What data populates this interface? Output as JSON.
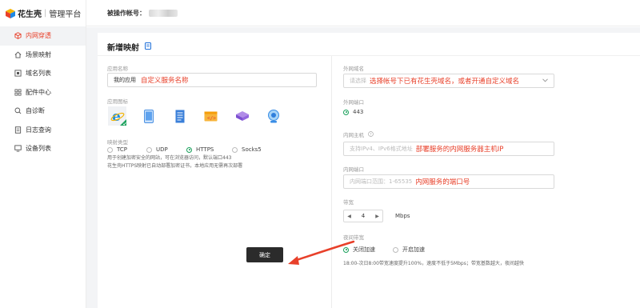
{
  "brand": {
    "name": "花生壳",
    "subtitle": "管理平台"
  },
  "header": {
    "account_label": "被操作帐号："
  },
  "sidebar": {
    "items": [
      {
        "label": "内网穿透",
        "icon": "cube-icon",
        "active": true
      },
      {
        "label": "场景映射",
        "icon": "home-icon",
        "active": false
      },
      {
        "label": "域名列表",
        "icon": "domain-icon",
        "active": false
      },
      {
        "label": "配件中心",
        "icon": "grid-icon",
        "active": false
      },
      {
        "label": "自诊断",
        "icon": "diagnose-icon",
        "active": false
      },
      {
        "label": "日志查询",
        "icon": "log-icon",
        "active": false
      },
      {
        "label": "设备列表",
        "icon": "monitor-icon",
        "active": false
      }
    ]
  },
  "form": {
    "title": "新增映射",
    "app_name": {
      "label": "应用名称",
      "value": "我的应用",
      "annotation": "自定义服务名称"
    },
    "app_icon": {
      "label": "应用图标",
      "icons": [
        "ie-browser-icon",
        "phone-icon",
        "document-icon",
        "code-icon",
        "database-icon",
        "webcam-icon"
      ]
    },
    "mapping_type": {
      "label": "映射类型",
      "options": [
        "TCP",
        "UDP",
        "HTTPS",
        "Socks5"
      ],
      "selected": "HTTPS"
    },
    "hint_lines": [
      "用于创建加密安全的网站，可在浏览器访问，默认端口443",
      "花生壳HTTPS映射已自动部署加密证书，本地应用无需再次部署"
    ],
    "external_domain": {
      "label": "外网域名",
      "placeholder": "请选择",
      "annotation": "选择帐号下已有花生壳域名，或者开通自定义域名"
    },
    "external_port": {
      "label": "外网端口",
      "value": "443"
    },
    "internal_host": {
      "label": "内网主机",
      "placeholder": "支持IPv4、IPv6格式地址",
      "annotation": "部署服务的内网服务器主机IP"
    },
    "internal_port": {
      "label": "内网端口",
      "placeholder": "内网端口范围：1-65535",
      "annotation": "内网服务的端口号"
    },
    "bandwidth": {
      "label": "带宽",
      "value": "4",
      "unit": "Mbps"
    },
    "night_bandwidth": {
      "label": "夜间带宽",
      "options": [
        "关闭加速",
        "开启加速"
      ],
      "selected": "关闭加速",
      "note": "18:00-次日8:00带宽速度提升100%，速度不低于5Mbps；带宽基数越大，夜间越快"
    },
    "confirm_label": "确定"
  },
  "colors": {
    "accent_red": "#e8402a",
    "radio_green": "#19a05b",
    "button_dark": "#2b2b2b"
  }
}
